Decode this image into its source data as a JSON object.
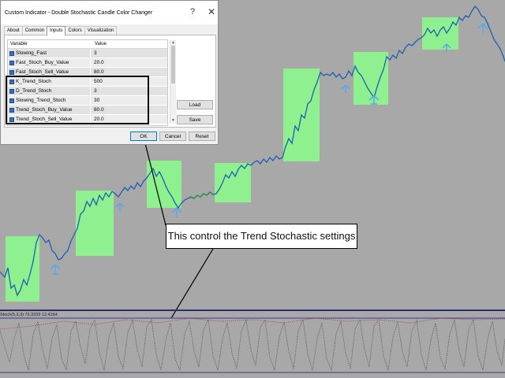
{
  "colors": {
    "chart_background": "#a8a8a8",
    "highlight_zone": "#8ff08f",
    "price_line_blue": "#1f5fb0",
    "price_line_green": "#2e8f3e",
    "arrow_blue": "#5aa8e8",
    "oscillator_dots": "#555555",
    "dialog_accent": "#0078d7"
  },
  "dialog": {
    "title": "Custom Indicator - Double Stochastic Candle Color Changer",
    "help_glyph": "?",
    "close_glyph": "✕",
    "tabs": [
      {
        "label": "About",
        "active": false
      },
      {
        "label": "Common",
        "active": false
      },
      {
        "label": "Inputs",
        "active": true
      },
      {
        "label": "Colors",
        "active": false
      },
      {
        "label": "Visualization",
        "active": false
      }
    ],
    "grid": {
      "header_variable": "Variable",
      "header_value": "Value",
      "rows": [
        {
          "variable": "Slowing_Fast",
          "value": "3"
        },
        {
          "variable": "Fast_Stoch_Buy_Value",
          "value": "20.0"
        },
        {
          "variable": "Fast_Stoch_Sell_Value",
          "value": "80.0"
        },
        {
          "variable": "K_Trend_Stoch",
          "value": "500"
        },
        {
          "variable": "D_Trend_Stoch",
          "value": "3"
        },
        {
          "variable": "Slowing_Trend_Stoch",
          "value": "30"
        },
        {
          "variable": "Trend_Stoch_Buy_Value",
          "value": "80.0"
        },
        {
          "variable": "Trend_Stoch_Sell_Value",
          "value": "20.0"
        }
      ]
    },
    "buttons": {
      "load": "Load",
      "save": "Save",
      "ok": "OK",
      "cancel": "Cancel",
      "reset": "Reset"
    }
  },
  "callout_text": "This control the Trend Stochastic settings",
  "oscillator_label": "Stoch(5,3,3) 73.3333 12.4164"
}
